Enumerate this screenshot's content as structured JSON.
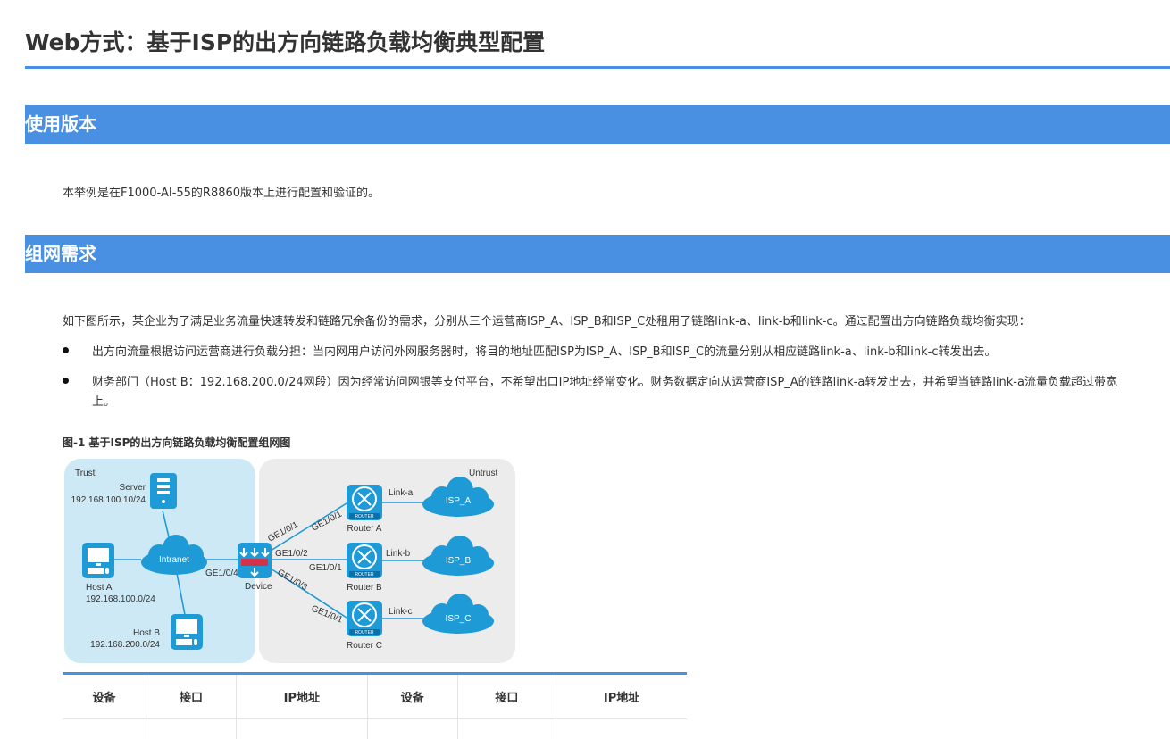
{
  "page": {
    "title": "Web方式：基于ISP的出方向链路负载均衡典型配置"
  },
  "sections": {
    "version": {
      "heading": "使用版本",
      "text": "本举例是在F1000-AI-55的R8860版本上进行配置和验证的。"
    },
    "network": {
      "heading": "组网需求",
      "intro": "如下图所示，某企业为了满足业务流量快速转发和链路冗余备份的需求，分别从三个运营商ISP_A、ISP_B和ISP_C处租用了链路link-a、link-b和link-c。通过配置出方向链路负载均衡实现：",
      "bullets": [
        {
          "line1": "出方向流量根据访问运营商进行负载分担：当内网用户访问外网服务器时，将目的地址匹配ISP为ISP_A、ISP_B和ISP_C的流量分别从相应链路link-a、link-b和link-c转发出去。",
          "line2": ""
        },
        {
          "line1": "财务部门（Host B：192.168.200.0/24网段）因为经常访问网银等支付平台，不希望出口IP地址经常变化。财务数据定向从运营商ISP_A的链路link-a转发出去，并希望当链路link-a流量负载超过带宽",
          "line2": "上。"
        }
      ]
    }
  },
  "figure": {
    "caption": "图-1 基于ISP的出方向链路负载均衡配置组网图",
    "zones": {
      "trust": "Trust",
      "untrust": "Untrust"
    },
    "nodes": {
      "server": {
        "name": "Server",
        "ip": "192.168.100.10/24"
      },
      "host_a": {
        "name": "Host A",
        "ip": "192.168.100.0/24"
      },
      "host_b": {
        "name": "Host B",
        "ip": "192.168.200.0/24"
      },
      "intranet": "Intranet",
      "device": "Device",
      "router_a": "Router A",
      "router_b": "Router B",
      "router_c": "Router C",
      "router_badge": "ROUTER",
      "isp_a": "ISP_A",
      "isp_b": "ISP_B",
      "isp_c": "ISP_C"
    },
    "links": {
      "link_a": "Link-a",
      "link_b": "Link-b",
      "link_c": "Link-c",
      "dev_ge1": "GE1/0/1",
      "dev_ge2": "GE1/0/2",
      "dev_ge3": "GE1/0/3",
      "dev_ge4": "GE1/0/4",
      "ra_ge": "GE1/0/1",
      "rb_ge": "GE1/0/1",
      "rc_ge": "GE1/0/1"
    },
    "colors": {
      "trust_zone": "#cde9f5",
      "untrust_zone": "#ececec",
      "node_blue": "#1e9ad6",
      "line": "#1e9ad6",
      "firewall_red": "#d2334a"
    }
  },
  "table": {
    "headers": [
      "设备",
      "接口",
      "IP地址",
      "设备",
      "接口",
      "IP地址"
    ]
  },
  "colors": {
    "accent": "#4a90e2",
    "text": "#333333"
  }
}
